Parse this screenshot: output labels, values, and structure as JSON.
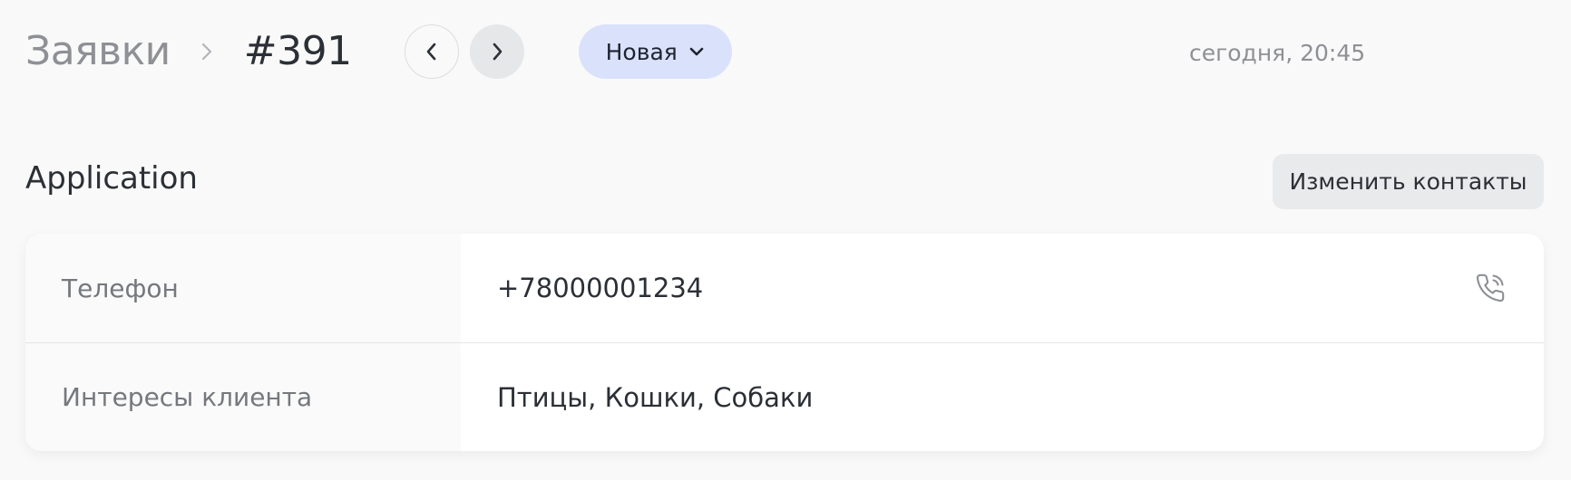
{
  "header": {
    "breadcrumb_parent": "Заявки",
    "breadcrumb_current": "#391",
    "status_label": "Новая",
    "timestamp": "сегодня, 20:45"
  },
  "icons": {
    "separator": "chevron-right-icon",
    "prev": "chevron-left-icon",
    "next": "chevron-right-icon",
    "status": "chevron-down-icon",
    "phone": "phone-call-icon"
  },
  "section": {
    "title": "Application",
    "edit_contacts_label": "Изменить контакты"
  },
  "fields": [
    {
      "label": "Телефон",
      "value": "+78000001234"
    },
    {
      "label": "Интересы клиента",
      "value": "Птицы, Кошки, Собаки"
    }
  ],
  "colors": {
    "background": "#f9f9f9",
    "status_pill": "#d9e1fb",
    "card": "#ffffff"
  }
}
